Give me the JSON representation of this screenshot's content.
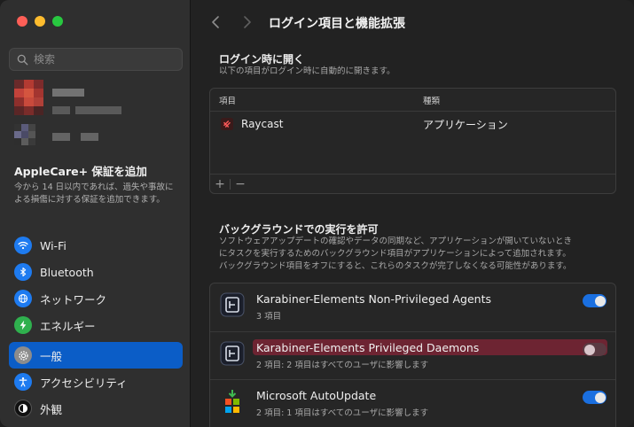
{
  "sidebar": {
    "search_placeholder": "検索",
    "applecare": {
      "title": "AppleCare+ 保証を追加",
      "description": "今から 14 日以内であれば、過失や事故による損傷に対する保証を追加できます。"
    },
    "items": [
      {
        "label": "Wi-Fi",
        "icon": "wifi-icon",
        "color": "#1e7bf0"
      },
      {
        "label": "Bluetooth",
        "icon": "bluetooth-icon",
        "color": "#1e7bf0"
      },
      {
        "label": "ネットワーク",
        "icon": "globe-icon",
        "color": "#1e7bf0"
      },
      {
        "label": "エネルギー",
        "icon": "bolt-icon",
        "color": "#2fb04e"
      },
      {
        "label": "一般",
        "icon": "gear-icon",
        "color": "#8c8c8c",
        "selected": true
      },
      {
        "label": "アクセシビリティ",
        "icon": "accessibility-icon",
        "color": "#1e7bf0"
      },
      {
        "label": "外観",
        "icon": "appearance-icon",
        "color": "#111111"
      }
    ]
  },
  "main": {
    "title": "ログイン項目と機能拡張",
    "login": {
      "title": "ログイン時に開く",
      "description": "以下の項目がログイン時に自動的に開きます。",
      "col_item": "項目",
      "col_kind": "種類",
      "rows": [
        {
          "name": "Raycast",
          "kind": "アプリケーション"
        }
      ],
      "add_label": "+",
      "remove_label": "−"
    },
    "background": {
      "title": "バックグラウンドでの実行を許可",
      "description_lines": [
        "ソフトウェアアップデートの確認やデータの同期など、アプリケーションが開いていないとき",
        "にタスクを実行するためのバックグラウンド項目がアプリケーションによって追加されます。",
        "バックグラウンド項目をオフにすると、これらのタスクが完了しなくなる可能性があります。"
      ],
      "items": [
        {
          "name": "Karabiner-Elements Non-Privileged Agents",
          "sub": "3 項目",
          "enabled": true
        },
        {
          "name": "Karabiner-Elements Privileged Daemons",
          "sub": "2 項目: 2 項目はすべてのユーザに影響します",
          "enabled": false
        },
        {
          "name": "Microsoft AutoUpdate",
          "sub": "2 項目: 1 項目はすべてのユーザに影響します",
          "enabled": true
        }
      ]
    }
  },
  "colors": {
    "accent": "#1a6fe0",
    "selection": "#0b5dc7",
    "highlight": "#7a2535"
  }
}
